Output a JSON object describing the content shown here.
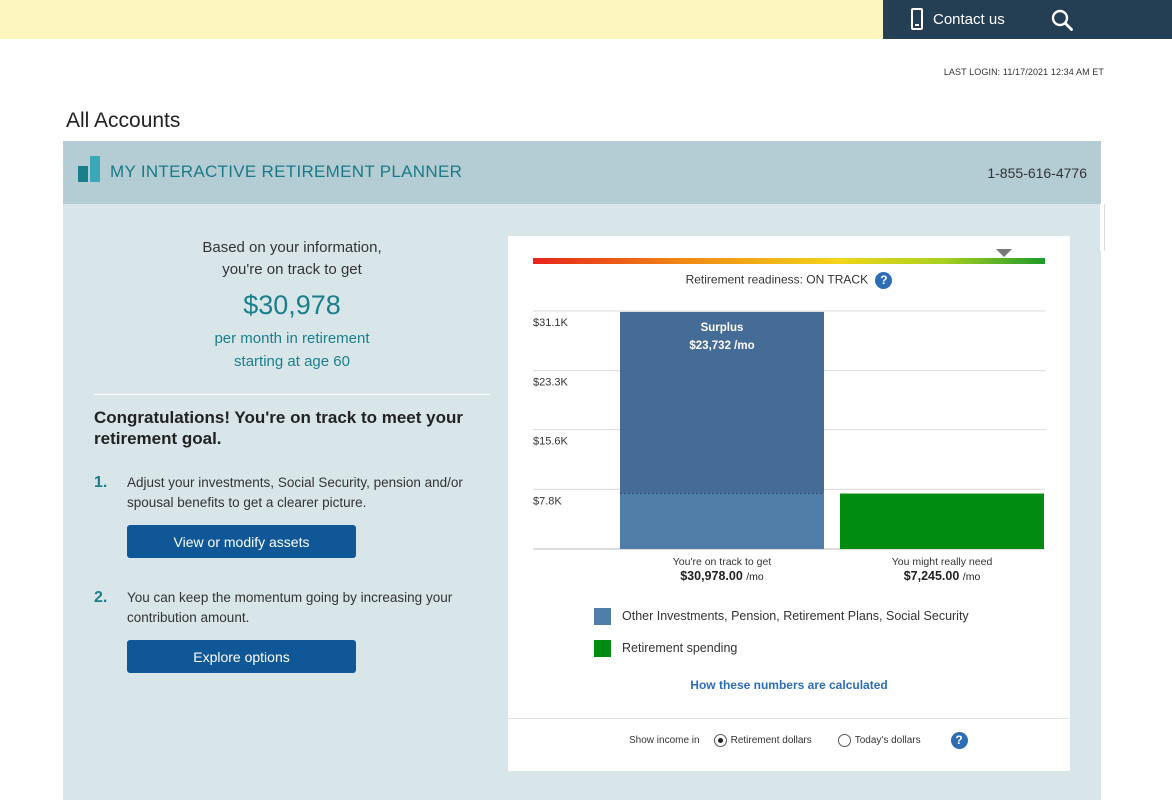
{
  "header": {
    "contact_label": "Contact us",
    "contact_icon": "phone-icon",
    "search_icon": "search-icon"
  },
  "last_login": "LAST LOGIN: 11/17/2021 12:34 AM ET",
  "page_title": "All Accounts",
  "planner": {
    "title": "MY INTERACTIVE RETIREMENT PLANNER",
    "phone": "1-855-616-4776",
    "summary": {
      "line1": "Based on your information,",
      "line2": "you're on track to get",
      "amount": "$30,978",
      "line3": "per month in retirement",
      "line4": "starting at age 60"
    },
    "congrats": "Congratulations! You're on track to meet your retirement goal.",
    "steps": [
      {
        "num": "1.",
        "text": "Adjust your investments, Social Security, pension and/or spousal benefits to get a clearer picture.",
        "button": "View or modify assets"
      },
      {
        "num": "2.",
        "text": "You can keep the momentum going by increasing your contribution amount.",
        "button": "Explore options"
      }
    ]
  },
  "readiness": {
    "label": "Retirement readiness: ON TRACK",
    "level": 0.92,
    "help": "?"
  },
  "chart_data": {
    "type": "bar",
    "categories": [
      "You're on track to get",
      "You might really need"
    ],
    "values": [
      30978,
      7245
    ],
    "surplus": {
      "label": "Surplus",
      "value_text": "$23,732 /mo",
      "value": 23732
    },
    "value_labels": [
      "$30,978.00",
      "$7,245.00"
    ],
    "unit_suffix": "/mo",
    "yticks": [
      {
        "label": "$31.1K",
        "value": 31100
      },
      {
        "label": "$23.3K",
        "value": 23300
      },
      {
        "label": "$15.6K",
        "value": 15600
      },
      {
        "label": "$7.8K",
        "value": 7800
      }
    ],
    "ylim": [
      0,
      31100
    ],
    "colors": {
      "surplus": "#456c96",
      "base": "#517ea9",
      "need": "#008c10"
    }
  },
  "legend": [
    {
      "label": "Other Investments, Pension, Retirement Plans, Social Security",
      "color": "#517ea9"
    },
    {
      "label": "Retirement spending",
      "color": "#008c10"
    }
  ],
  "calc_link": "How these numbers are calculated",
  "income_toggle": {
    "label": "Show income in",
    "options": [
      "Retirement dollars",
      "Today's dollars"
    ],
    "selected": "Retirement dollars"
  }
}
